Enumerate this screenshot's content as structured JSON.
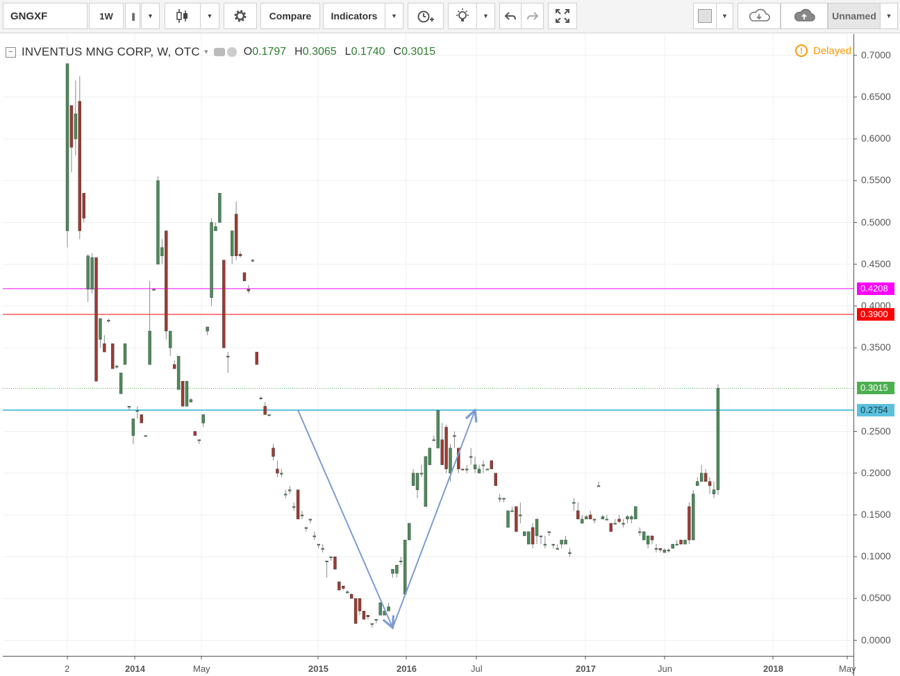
{
  "toolbar": {
    "symbol": "GNGXF",
    "interval": "1W",
    "compare_label": "Compare",
    "indicators_label": "Indicators",
    "layout_name": "Unnamed"
  },
  "legend": {
    "title": "INVENTUS MNG CORP, W, OTC",
    "open_key": "O",
    "open": "0.1797",
    "high_key": "H",
    "high": "0.3065",
    "low_key": "L",
    "low": "0.1740",
    "close_key": "C",
    "close": "0.3015"
  },
  "status": {
    "delayed_label": "Delayed"
  },
  "price_axis": {
    "ticks": [
      "0.7000",
      "0.6500",
      "0.6000",
      "0.5500",
      "0.5000",
      "0.4500",
      "0.4000",
      "0.3500",
      "0.2500",
      "0.2000",
      "0.1500",
      "0.1000",
      "0.0500",
      "0.0000"
    ]
  },
  "time_axis": {
    "labels": [
      "2",
      "2014",
      "May",
      "2015",
      "2016",
      "Jul",
      "2017",
      "Jun",
      "2018",
      "May"
    ]
  },
  "price_lines": [
    {
      "label": "0.4208",
      "value": 0.4208,
      "color": "#ff00ff"
    },
    {
      "label": "0.3900",
      "value": 0.39,
      "color": "#ff0000"
    },
    {
      "label": "0.3015",
      "value": 0.3015,
      "color": "#4caf50"
    },
    {
      "label": "0.2754",
      "value": 0.2754,
      "color": "#5bc0de"
    }
  ],
  "colors": {
    "up": "#4d8a5a",
    "down": "#9b3b32",
    "accent": "#ff9800",
    "trend": "#7e9bd1"
  },
  "chart_data": {
    "type": "candlestick",
    "title": "INVENTUS MNG CORP, W, OTC",
    "ylim": [
      -0.01,
      0.72
    ],
    "trend_points": [
      {
        "t": 56,
        "p": 0.2754
      },
      {
        "t": 79,
        "p": 0.015
      },
      {
        "t": 99,
        "p": 0.2754
      }
    ],
    "candles": [
      [
        0,
        0.49,
        0.69,
        0.47,
        0.69
      ],
      [
        1,
        0.64,
        0.64,
        0.56,
        0.59
      ],
      [
        2,
        0.6,
        0.67,
        0.58,
        0.63
      ],
      [
        3,
        0.645,
        0.675,
        0.48,
        0.49
      ],
      [
        4,
        0.535,
        0.535,
        0.5,
        0.505
      ],
      [
        5,
        0.42,
        0.462,
        0.405,
        0.46
      ],
      [
        6,
        0.42,
        0.463,
        0.415,
        0.458
      ],
      [
        7,
        0.458,
        0.458,
        0.31,
        0.31
      ],
      [
        8,
        0.36,
        0.385,
        0.35,
        0.385
      ],
      [
        9,
        0.355,
        0.365,
        0.345,
        0.345
      ],
      [
        10,
        0.383,
        0.385,
        0.38,
        0.383
      ],
      [
        11,
        0.355,
        0.355,
        0.325,
        0.325
      ],
      [
        12,
        0.328,
        0.33,
        0.325,
        0.328
      ],
      [
        13,
        0.295,
        0.32,
        0.295,
        0.32
      ],
      [
        14,
        0.33,
        0.355,
        0.33,
        0.355
      ],
      [
        15,
        0.28,
        0.28,
        0.275,
        0.28
      ],
      [
        16,
        0.245,
        0.265,
        0.235,
        0.265
      ],
      [
        17,
        0.275,
        0.28,
        0.265,
        0.275
      ],
      [
        18,
        0.27,
        0.27,
        0.26,
        0.26
      ],
      [
        19,
        0.245,
        0.245,
        0.245,
        0.245
      ],
      [
        20,
        0.33,
        0.43,
        0.33,
        0.37
      ],
      [
        21,
        0.42,
        0.42,
        0.42,
        0.42
      ],
      [
        22,
        0.45,
        0.555,
        0.45,
        0.55
      ],
      [
        23,
        0.46,
        0.48,
        0.45,
        0.47
      ],
      [
        24,
        0.49,
        0.49,
        0.36,
        0.37
      ],
      [
        25,
        0.35,
        0.37,
        0.34,
        0.37
      ],
      [
        26,
        0.33,
        0.335,
        0.325,
        0.325
      ],
      [
        27,
        0.3,
        0.34,
        0.3,
        0.34
      ],
      [
        28,
        0.31,
        0.31,
        0.28,
        0.28
      ],
      [
        29,
        0.28,
        0.31,
        0.28,
        0.31
      ],
      [
        30,
        0.285,
        0.29,
        0.285,
        0.288
      ],
      [
        31,
        0.25,
        0.25,
        0.245,
        0.245
      ],
      [
        32,
        0.24,
        0.24,
        0.235,
        0.24
      ],
      [
        33,
        0.26,
        0.27,
        0.255,
        0.27
      ],
      [
        34,
        0.37,
        0.375,
        0.365,
        0.375
      ],
      [
        35,
        0.41,
        0.505,
        0.4,
        0.5
      ],
      [
        36,
        0.49,
        0.5,
        0.49,
        0.495
      ],
      [
        37,
        0.5,
        0.535,
        0.5,
        0.535
      ],
      [
        38,
        0.455,
        0.455,
        0.35,
        0.35
      ],
      [
        39,
        0.34,
        0.345,
        0.32,
        0.34
      ],
      [
        40,
        0.46,
        0.49,
        0.45,
        0.49
      ],
      [
        41,
        0.51,
        0.525,
        0.455,
        0.46
      ],
      [
        42,
        0.462,
        0.465,
        0.458,
        0.46
      ],
      [
        43,
        0.44,
        0.44,
        0.43,
        0.43
      ],
      [
        44,
        0.42,
        0.425,
        0.415,
        0.418
      ],
      [
        45,
        0.455,
        0.456,
        0.452,
        0.455
      ],
      [
        46,
        0.345,
        0.345,
        0.33,
        0.33
      ],
      [
        47,
        0.29,
        0.292,
        0.288,
        0.29
      ],
      [
        48,
        0.28,
        0.285,
        0.27,
        0.27
      ],
      [
        49,
        0.27,
        0.27,
        0.268,
        0.27
      ],
      [
        50,
        0.23,
        0.235,
        0.215,
        0.22
      ],
      [
        51,
        0.205,
        0.215,
        0.195,
        0.2
      ],
      [
        52,
        0.2,
        0.205,
        0.195,
        0.2
      ],
      [
        53,
        0.175,
        0.18,
        0.17,
        0.175
      ],
      [
        54,
        0.18,
        0.185,
        0.175,
        0.18
      ],
      [
        55,
        0.16,
        0.165,
        0.155,
        0.16
      ],
      [
        56,
        0.18,
        0.18,
        0.145,
        0.145
      ],
      [
        57,
        0.15,
        0.155,
        0.145,
        0.15
      ],
      [
        58,
        0.135,
        0.135,
        0.13,
        0.135
      ],
      [
        59,
        0.145,
        0.145,
        0.14,
        0.145
      ],
      [
        60,
        0.125,
        0.13,
        0.12,
        0.125
      ],
      [
        61,
        0.115,
        0.115,
        0.11,
        0.115
      ],
      [
        62,
        0.11,
        0.115,
        0.105,
        0.11
      ],
      [
        63,
        0.095,
        0.095,
        0.075,
        0.095
      ],
      [
        64,
        0.1,
        0.1,
        0.095,
        0.1
      ],
      [
        65,
        0.1,
        0.1,
        0.085,
        0.085
      ],
      [
        66,
        0.07,
        0.07,
        0.06,
        0.06
      ],
      [
        67,
        0.065,
        0.065,
        0.06,
        0.062
      ],
      [
        68,
        0.058,
        0.06,
        0.056,
        0.058
      ],
      [
        69,
        0.055,
        0.056,
        0.05,
        0.05
      ],
      [
        70,
        0.05,
        0.05,
        0.02,
        0.02
      ],
      [
        71,
        0.05,
        0.05,
        0.03,
        0.035
      ],
      [
        72,
        0.035,
        0.035,
        0.025,
        0.025
      ],
      [
        73,
        0.03,
        0.03,
        0.025,
        0.028
      ],
      [
        74,
        0.02,
        0.02,
        0.015,
        0.02
      ],
      [
        75,
        0.025,
        0.025,
        0.02,
        0.025
      ],
      [
        76,
        0.03,
        0.045,
        0.03,
        0.045
      ],
      [
        77,
        0.03,
        0.035,
        0.03,
        0.035
      ],
      [
        78,
        0.035,
        0.045,
        0.035,
        0.04
      ],
      [
        79,
        0.08,
        0.085,
        0.075,
        0.085
      ],
      [
        80,
        0.08,
        0.09,
        0.075,
        0.09
      ],
      [
        81,
        0.095,
        0.1,
        0.09,
        0.095
      ],
      [
        82,
        0.055,
        0.12,
        0.055,
        0.12
      ],
      [
        83,
        0.12,
        0.14,
        0.12,
        0.14
      ],
      [
        84,
        0.185,
        0.205,
        0.185,
        0.2
      ],
      [
        85,
        0.18,
        0.2,
        0.17,
        0.2
      ],
      [
        86,
        0.2,
        0.21,
        0.195,
        0.2
      ],
      [
        87,
        0.16,
        0.22,
        0.16,
        0.22
      ],
      [
        88,
        0.21,
        0.23,
        0.21,
        0.23
      ],
      [
        89,
        0.24,
        0.245,
        0.24,
        0.24
      ],
      [
        90,
        0.23,
        0.275,
        0.23,
        0.275
      ],
      [
        91,
        0.24,
        0.26,
        0.21,
        0.21
      ],
      [
        92,
        0.255,
        0.258,
        0.2,
        0.205
      ],
      [
        93,
        0.2,
        0.235,
        0.19,
        0.23
      ],
      [
        94,
        0.245,
        0.25,
        0.23,
        0.245
      ],
      [
        95,
        0.23,
        0.23,
        0.2,
        0.205
      ],
      [
        96,
        0.205,
        0.205,
        0.203,
        0.204
      ],
      [
        97,
        0.205,
        0.21,
        0.2,
        0.205
      ],
      [
        98,
        0.22,
        0.23,
        0.21,
        0.22
      ],
      [
        99,
        0.205,
        0.22,
        0.2,
        0.21
      ],
      [
        100,
        0.2,
        0.21,
        0.2,
        0.205
      ],
      [
        101,
        0.21,
        0.215,
        0.2,
        0.21
      ],
      [
        102,
        0.205,
        0.205,
        0.205,
        0.205
      ],
      [
        103,
        0.215,
        0.215,
        0.205,
        0.205
      ],
      [
        104,
        0.2,
        0.2,
        0.185,
        0.185
      ],
      [
        105,
        0.17,
        0.175,
        0.165,
        0.17
      ],
      [
        106,
        0.17,
        0.17,
        0.165,
        0.17
      ],
      [
        107,
        0.135,
        0.155,
        0.135,
        0.155
      ],
      [
        108,
        0.155,
        0.16,
        0.155,
        0.155
      ],
      [
        109,
        0.16,
        0.16,
        0.13,
        0.13
      ],
      [
        110,
        0.15,
        0.165,
        0.14,
        0.15
      ],
      [
        111,
        0.125,
        0.13,
        0.125,
        0.13
      ],
      [
        112,
        0.115,
        0.13,
        0.115,
        0.13
      ],
      [
        113,
        0.135,
        0.14,
        0.11,
        0.115
      ],
      [
        114,
        0.125,
        0.145,
        0.115,
        0.145
      ],
      [
        115,
        0.125,
        0.125,
        0.115,
        0.125
      ],
      [
        116,
        0.115,
        0.125,
        0.11,
        0.115
      ],
      [
        117,
        0.13,
        0.13,
        0.125,
        0.13
      ],
      [
        118,
        0.115,
        0.115,
        0.11,
        0.115
      ],
      [
        119,
        0.11,
        0.115,
        0.11,
        0.11
      ],
      [
        120,
        0.115,
        0.12,
        0.11,
        0.12
      ],
      [
        121,
        0.115,
        0.125,
        0.115,
        0.12
      ],
      [
        122,
        0.105,
        0.11,
        0.1,
        0.105
      ],
      [
        123,
        0.165,
        0.17,
        0.155,
        0.165
      ],
      [
        124,
        0.155,
        0.165,
        0.145,
        0.145
      ],
      [
        125,
        0.14,
        0.15,
        0.14,
        0.145
      ],
      [
        126,
        0.145,
        0.15,
        0.145,
        0.148
      ],
      [
        127,
        0.15,
        0.155,
        0.145,
        0.145
      ],
      [
        128,
        0.145,
        0.145,
        0.14,
        0.145
      ],
      [
        129,
        0.185,
        0.19,
        0.185,
        0.185
      ],
      [
        130,
        0.145,
        0.15,
        0.145,
        0.148
      ],
      [
        131,
        0.145,
        0.15,
        0.145,
        0.145
      ],
      [
        132,
        0.14,
        0.14,
        0.13,
        0.13
      ],
      [
        133,
        0.14,
        0.145,
        0.14,
        0.14
      ],
      [
        134,
        0.145,
        0.15,
        0.14,
        0.142
      ],
      [
        135,
        0.14,
        0.145,
        0.135,
        0.14
      ],
      [
        136,
        0.145,
        0.15,
        0.14,
        0.148
      ],
      [
        137,
        0.145,
        0.15,
        0.14,
        0.148
      ],
      [
        138,
        0.145,
        0.16,
        0.145,
        0.16
      ],
      [
        139,
        0.13,
        0.135,
        0.125,
        0.13
      ],
      [
        140,
        0.12,
        0.13,
        0.12,
        0.13
      ],
      [
        141,
        0.115,
        0.125,
        0.11,
        0.125
      ],
      [
        142,
        0.125,
        0.125,
        0.115,
        0.12
      ],
      [
        143,
        0.11,
        0.115,
        0.105,
        0.11
      ],
      [
        144,
        0.11,
        0.11,
        0.105,
        0.108
      ],
      [
        145,
        0.105,
        0.11,
        0.105,
        0.108
      ],
      [
        146,
        0.108,
        0.11,
        0.105,
        0.108
      ],
      [
        147,
        0.11,
        0.115,
        0.11,
        0.115
      ],
      [
        148,
        0.115,
        0.12,
        0.115,
        0.115
      ],
      [
        149,
        0.12,
        0.12,
        0.115,
        0.115
      ],
      [
        150,
        0.115,
        0.12,
        0.115,
        0.12
      ],
      [
        151,
        0.16,
        0.165,
        0.115,
        0.12
      ],
      [
        152,
        0.12,
        0.18,
        0.12,
        0.175
      ],
      [
        153,
        0.185,
        0.195,
        0.185,
        0.19
      ],
      [
        154,
        0.19,
        0.21,
        0.19,
        0.2
      ],
      [
        155,
        0.2,
        0.205,
        0.19,
        0.19
      ],
      [
        156,
        0.19,
        0.195,
        0.175,
        0.185
      ],
      [
        157,
        0.175,
        0.19,
        0.17,
        0.18
      ],
      [
        158,
        0.18,
        0.3065,
        0.174,
        0.3015
      ]
    ]
  }
}
